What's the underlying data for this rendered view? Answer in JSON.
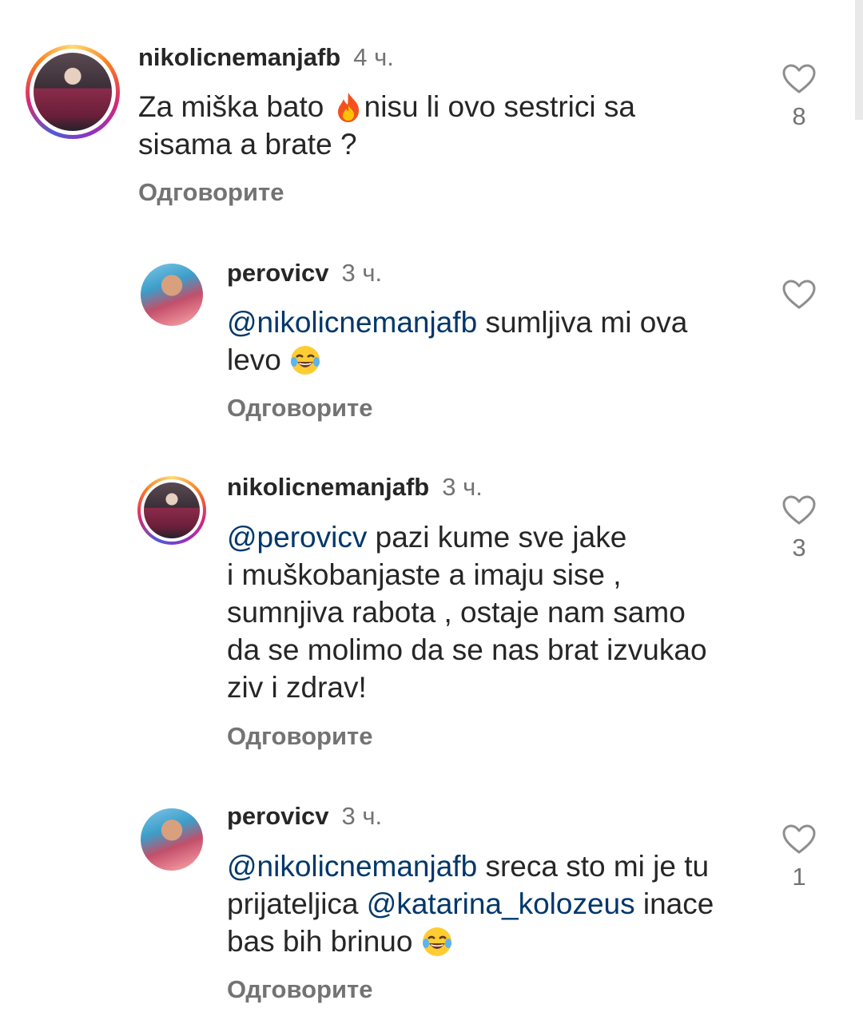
{
  "comments": [
    {
      "username": "nikolicnemanjafb",
      "time": "4 ч.",
      "text1": "Za miška bato ",
      "text2": "nisu li ovo sestrici sa",
      "text3": "sisama a brate ?",
      "emoji": "fire-emoji",
      "reply": "Одговорите",
      "likes": "8"
    },
    {
      "username": "perovicv",
      "time": "3 ч.",
      "mention": "@nikolicnemanjafb",
      "text1": " sumljiva mi ova",
      "text2": "levo ",
      "emoji": "tears-of-joy-emoji",
      "reply": "Одговорите"
    },
    {
      "username": "nikolicnemanjafb",
      "time": "3 ч.",
      "mention": "@perovicv",
      "text1": " pazi kume sve jake",
      "text2": "i muškobanjaste a imaju sise ,",
      "text3": "sumnjiva rabota , ostaje nam samo",
      "text4": "da se molimo da se nas brat izvukao",
      "text5": "ziv i zdrav!",
      "reply": "Одговорите",
      "likes": "3"
    },
    {
      "username": "perovicv",
      "time": "3 ч.",
      "mention": "@nikolicnemanjafb",
      "text1": " sreca sto mi je tu",
      "text2": "prijateljica ",
      "mention2": "@katarina_kolozeus",
      "text3": " inace",
      "text4": "bas bih brinuo ",
      "emoji": "tears-of-joy-emoji",
      "reply": "Одговорите",
      "likes": "1"
    }
  ]
}
